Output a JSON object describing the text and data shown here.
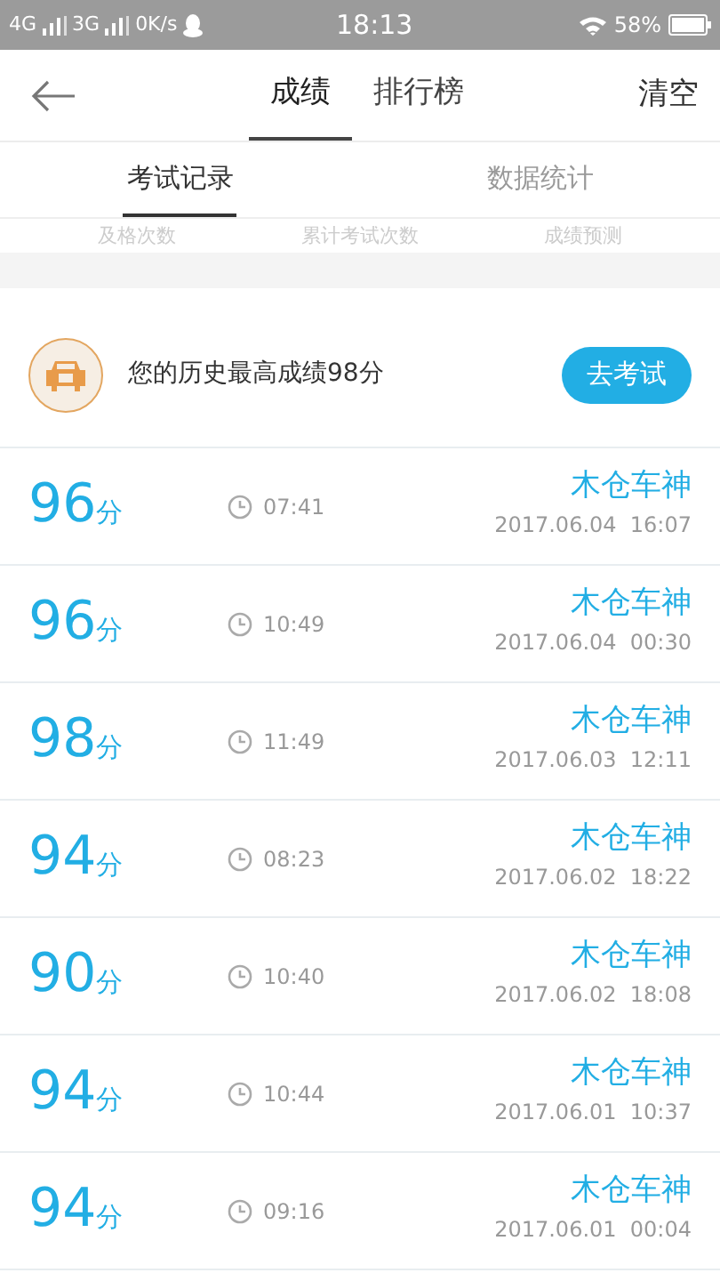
{
  "status_bar": {
    "network_1": "4G",
    "network_2": "3G",
    "speed": "0K/s",
    "time": "18:13",
    "battery": "58%"
  },
  "header": {
    "tabs": [
      {
        "label": "成绩",
        "selected": true
      },
      {
        "label": "排行榜",
        "selected": false
      }
    ],
    "action": "清空"
  },
  "sub_tabs": [
    {
      "label": "考试记录",
      "selected": true
    },
    {
      "label": "数据统计",
      "selected": false
    }
  ],
  "stat_labels": [
    "及格次数",
    "累计考试次数",
    "成绩预测"
  ],
  "banner": {
    "text": "您的历史最高成绩98分",
    "button": "去考试"
  },
  "records": [
    {
      "score": "96",
      "unit": "分",
      "duration": "07:41",
      "name": "木仓车神",
      "date": "2017.06.04  16:07"
    },
    {
      "score": "96",
      "unit": "分",
      "duration": "10:49",
      "name": "木仓车神",
      "date": "2017.06.04  00:30"
    },
    {
      "score": "98",
      "unit": "分",
      "duration": "11:49",
      "name": "木仓车神",
      "date": "2017.06.03  12:11"
    },
    {
      "score": "94",
      "unit": "分",
      "duration": "08:23",
      "name": "木仓车神",
      "date": "2017.06.02  18:22"
    },
    {
      "score": "90",
      "unit": "分",
      "duration": "10:40",
      "name": "木仓车神",
      "date": "2017.06.02  18:08"
    },
    {
      "score": "94",
      "unit": "分",
      "duration": "10:44",
      "name": "木仓车神",
      "date": "2017.06.01  10:37"
    },
    {
      "score": "94",
      "unit": "分",
      "duration": "09:16",
      "name": "木仓车神",
      "date": "2017.06.01  00:04"
    }
  ]
}
